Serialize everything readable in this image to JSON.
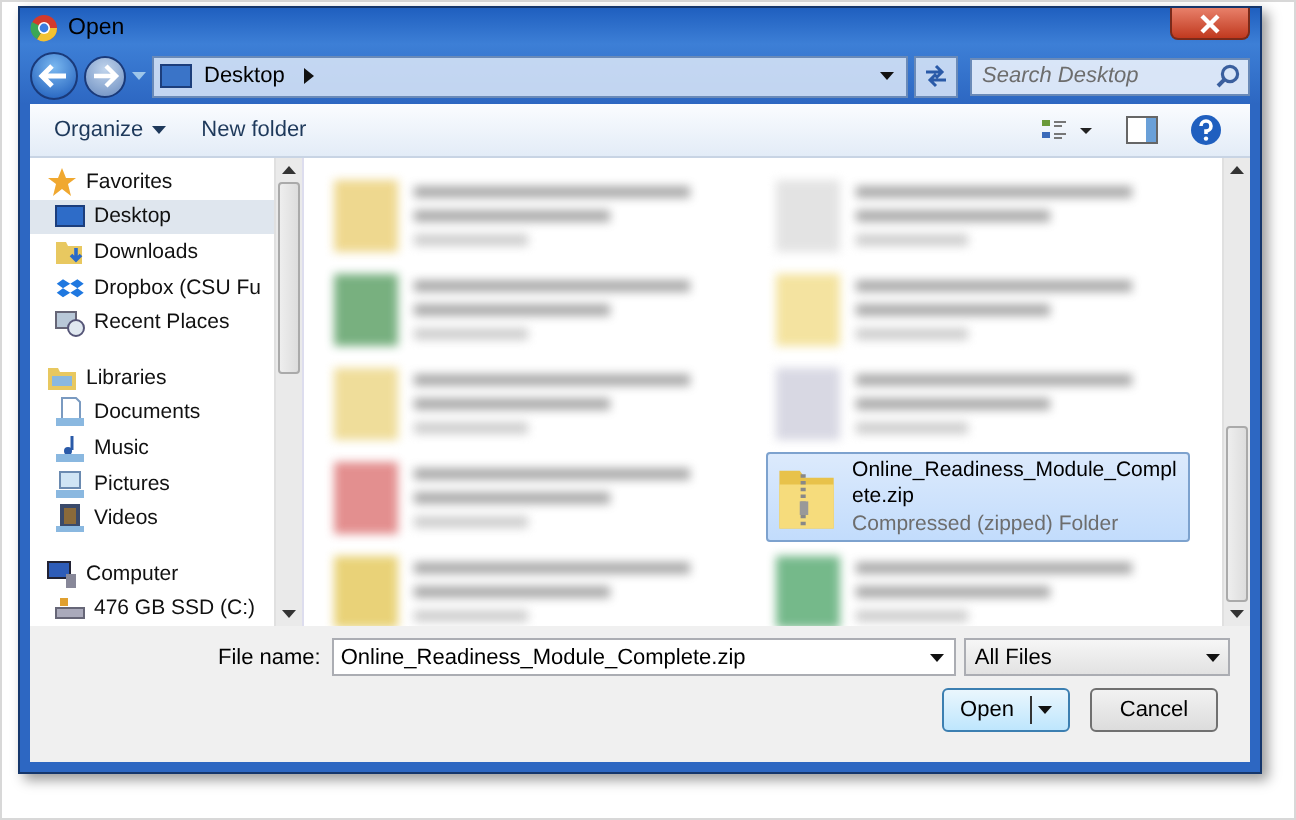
{
  "window": {
    "title": "Open"
  },
  "address": {
    "location": "Desktop",
    "search_placeholder": "Search Desktop"
  },
  "toolbar": {
    "organize": "Organize",
    "new_folder": "New folder"
  },
  "navigation": [
    {
      "label": "Favorites",
      "kind": "star",
      "selected": false,
      "children": [
        {
          "label": "Desktop",
          "kind": "desktop",
          "selected": true
        },
        {
          "label": "Downloads",
          "kind": "downloads",
          "selected": false
        },
        {
          "label": "Dropbox (CSU Fu",
          "kind": "dropbox",
          "selected": false
        },
        {
          "label": "Recent Places",
          "kind": "recent",
          "selected": false
        }
      ]
    },
    {
      "label": "Libraries",
      "kind": "libraries",
      "selected": false,
      "children": [
        {
          "label": "Documents",
          "kind": "documents",
          "selected": false
        },
        {
          "label": "Music",
          "kind": "music",
          "selected": false
        },
        {
          "label": "Pictures",
          "kind": "pictures",
          "selected": false
        },
        {
          "label": "Videos",
          "kind": "videos",
          "selected": false
        }
      ]
    },
    {
      "label": "Computer",
      "kind": "computer",
      "selected": false,
      "children": [
        {
          "label": "476 GB SSD (C:)",
          "kind": "drive",
          "selected": false
        }
      ]
    }
  ],
  "files": [
    {
      "kind": "blurred",
      "selected": false
    },
    {
      "kind": "blurred",
      "selected": false
    },
    {
      "kind": "blurred",
      "selected": false
    },
    {
      "kind": "blurred",
      "selected": false
    },
    {
      "kind": "blurred",
      "selected": false
    },
    {
      "kind": "blurred",
      "selected": false
    },
    {
      "kind": "blurred",
      "selected": false
    },
    {
      "kind": "file",
      "name": "Online_Readiness_Module_Complete.zip",
      "type": "Compressed (zipped) Folder",
      "selected": true
    },
    {
      "kind": "blurred",
      "selected": false
    },
    {
      "kind": "blurred",
      "selected": false
    }
  ],
  "footer": {
    "file_name_label": "File name:",
    "file_name": "Online_Readiness_Module_Complete.zip",
    "filter": "All Files",
    "open": "Open",
    "cancel": "Cancel"
  }
}
